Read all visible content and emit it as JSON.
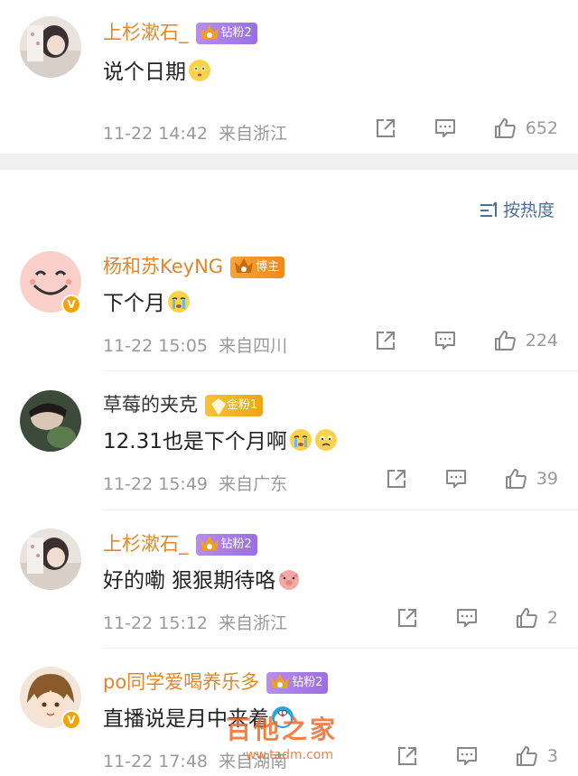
{
  "comments": [
    {
      "username": "上杉漱石_",
      "badge": "钻粉2",
      "text": "说个日期",
      "time": "11-22 14:42",
      "location": "来自浙江",
      "likes": "652",
      "emoji": "face-icon"
    },
    {
      "username": "杨和苏KeyNG",
      "badge": "博主",
      "text": "下个月",
      "time": "11-22 15:05",
      "location": "来自四川",
      "likes": "224",
      "emoji": "crying-icon"
    },
    {
      "username": "草莓的夹克",
      "badge": "金粉1",
      "text": "12.31也是下个月啊",
      "time": "11-22 15:49",
      "location": "来自广东",
      "likes": "39",
      "emoji": "crying-icon"
    },
    {
      "username": "上杉漱石_",
      "badge": "钻粉2",
      "text": "好的嘞 狠狠期待咯",
      "time": "11-22 15:12",
      "location": "来自浙江",
      "likes": "2",
      "emoji": "pig-icon"
    },
    {
      "username": "po同学爱喝养乐多",
      "badge": "钻粉2",
      "text": "直播说是月中来着",
      "time": "11-22 17:48",
      "location": "来自湖南",
      "likes": "3",
      "emoji": "doraemon-icon"
    }
  ],
  "sort_label": "按热度",
  "watermark": "百他之家",
  "watermark_url": "ww.tadm.com",
  "colors": {
    "username": "#e3862a",
    "meta": "#999999",
    "sort": "#4a6f99"
  }
}
